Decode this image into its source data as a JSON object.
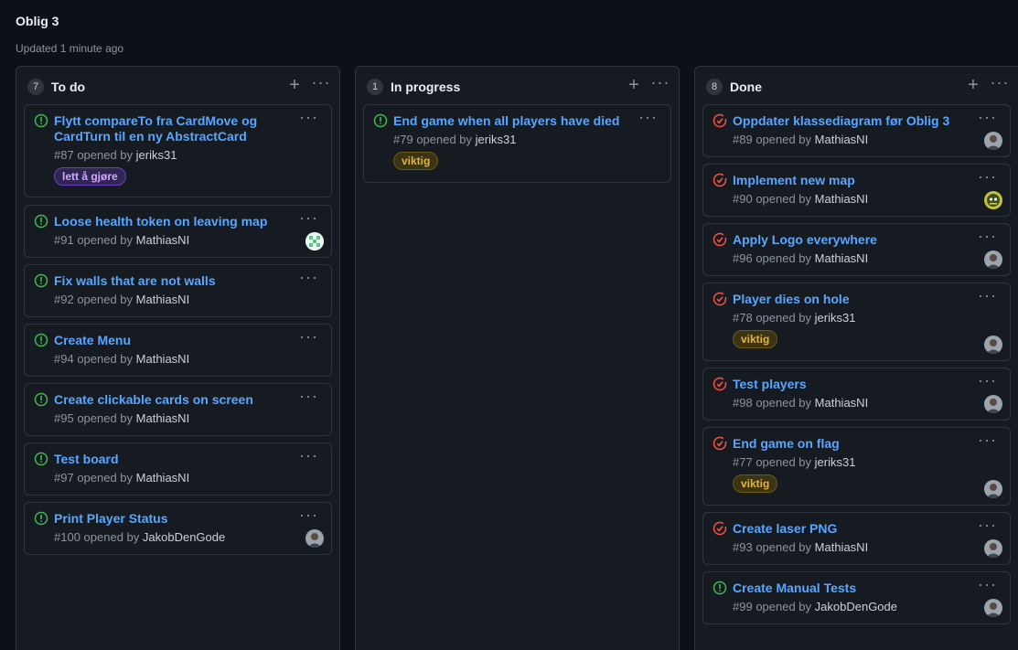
{
  "page": {
    "title": "Oblig 3",
    "updated": "Updated 1 minute ago"
  },
  "colors": {
    "open": "#3fb950",
    "closed": "#f85149",
    "link": "#58a6ff"
  },
  "columns": [
    {
      "count": "7",
      "title": "To do",
      "cards": [
        {
          "title_lines": [
            "Flytt compareTo fra CardMove og",
            "CardTurn til en ny AbstractCard"
          ],
          "number": "#87",
          "opened_by": "opened by",
          "user": "jeriks31",
          "label": "lett å gjøre",
          "state": "open"
        },
        {
          "title_lines": [
            "Loose health token on leaving map"
          ],
          "number": "#91",
          "opened_by": "opened by",
          "user": "MathiasNI",
          "state": "open",
          "avatar": "avatar-green"
        },
        {
          "title_lines": [
            "Fix walls that are not walls"
          ],
          "number": "#92",
          "opened_by": "opened by",
          "user": "MathiasNI",
          "state": "open"
        },
        {
          "title_lines": [
            "Create Menu"
          ],
          "number": "#94",
          "opened_by": "opened by",
          "user": "MathiasNI",
          "state": "open"
        },
        {
          "title_lines": [
            "Create clickable cards on screen"
          ],
          "number": "#95",
          "opened_by": "opened by",
          "user": "MathiasNI",
          "state": "open"
        },
        {
          "title_lines": [
            "Test board"
          ],
          "number": "#97",
          "opened_by": "opened by",
          "user": "MathiasNI",
          "state": "open"
        },
        {
          "title_lines": [
            "Print Player Status"
          ],
          "number": "#100",
          "opened_by": "opened by",
          "user": "JakobDenGode",
          "state": "open",
          "avatar": "avatar-photo"
        }
      ]
    },
    {
      "count": "1",
      "title": "In progress",
      "cards": [
        {
          "title_lines": [
            "End game when all players have died"
          ],
          "number": "#79",
          "opened_by": "opened by",
          "user": "jeriks31",
          "label": "viktig",
          "state": "open"
        }
      ]
    },
    {
      "count": "8",
      "title": "Done",
      "cards": [
        {
          "title_lines": [
            "Oppdater klassediagram før Oblig 3"
          ],
          "number": "#89",
          "opened_by": "opened by",
          "user": "MathiasNI",
          "state": "closed",
          "avatar": "avatar-photo"
        },
        {
          "title_lines": [
            "Implement new map"
          ],
          "number": "#90",
          "opened_by": "opened by",
          "user": "MathiasNI",
          "state": "closed",
          "avatar": "avatar-yellow"
        },
        {
          "title_lines": [
            "Apply Logo everywhere"
          ],
          "number": "#96",
          "opened_by": "opened by",
          "user": "MathiasNI",
          "state": "closed",
          "avatar": "avatar-photo"
        },
        {
          "title_lines": [
            "Player dies on hole"
          ],
          "number": "#78",
          "opened_by": "opened by",
          "user": "jeriks31",
          "label": "viktig",
          "state": "closed",
          "avatar": "avatar-photo"
        },
        {
          "title_lines": [
            "Test players"
          ],
          "number": "#98",
          "opened_by": "opened by",
          "user": "MathiasNI",
          "state": "closed",
          "avatar": "avatar-photo"
        },
        {
          "title_lines": [
            "End game on flag"
          ],
          "number": "#77",
          "opened_by": "opened by",
          "user": "jeriks31",
          "label": "viktig",
          "state": "closed",
          "avatar": "avatar-photo"
        },
        {
          "title_lines": [
            "Create laser PNG"
          ],
          "number": "#93",
          "opened_by": "opened by",
          "user": "MathiasNI",
          "state": "closed",
          "avatar": "avatar-photo"
        },
        {
          "title_lines": [
            "Create Manual Tests"
          ],
          "number": "#99",
          "opened_by": "opened by",
          "user": "JakobDenGode",
          "state": "open",
          "avatar": "avatar-photo"
        }
      ]
    }
  ]
}
